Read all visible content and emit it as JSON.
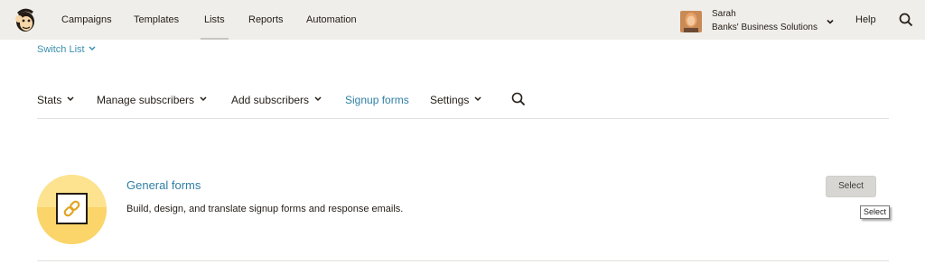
{
  "header": {
    "logo_icon": "freddie-monkey-logo",
    "nav": [
      {
        "label": "Campaigns"
      },
      {
        "label": "Templates"
      },
      {
        "label": "Lists",
        "active": true
      },
      {
        "label": "Reports"
      },
      {
        "label": "Automation"
      }
    ],
    "user": {
      "name": "Sarah",
      "organization": "Banks' Business Solutions",
      "avatar_icon": "user-avatar"
    },
    "help_label": "Help",
    "search_icon": "search-icon"
  },
  "switch_list": {
    "label": "Switch List"
  },
  "subnav": {
    "items": [
      {
        "label": "Stats"
      },
      {
        "label": "Manage subscribers"
      },
      {
        "label": "Add subscribers"
      },
      {
        "label": "Signup forms",
        "active": true
      },
      {
        "label": "Settings"
      }
    ],
    "active_color": "#2f7fa3"
  },
  "feature": {
    "icon": "link-icon",
    "title": "General forms",
    "description": "Build, design, and translate signup forms and response emails.",
    "button_label": "Select",
    "tooltip": "Select",
    "accent_color": "#fde28f"
  }
}
